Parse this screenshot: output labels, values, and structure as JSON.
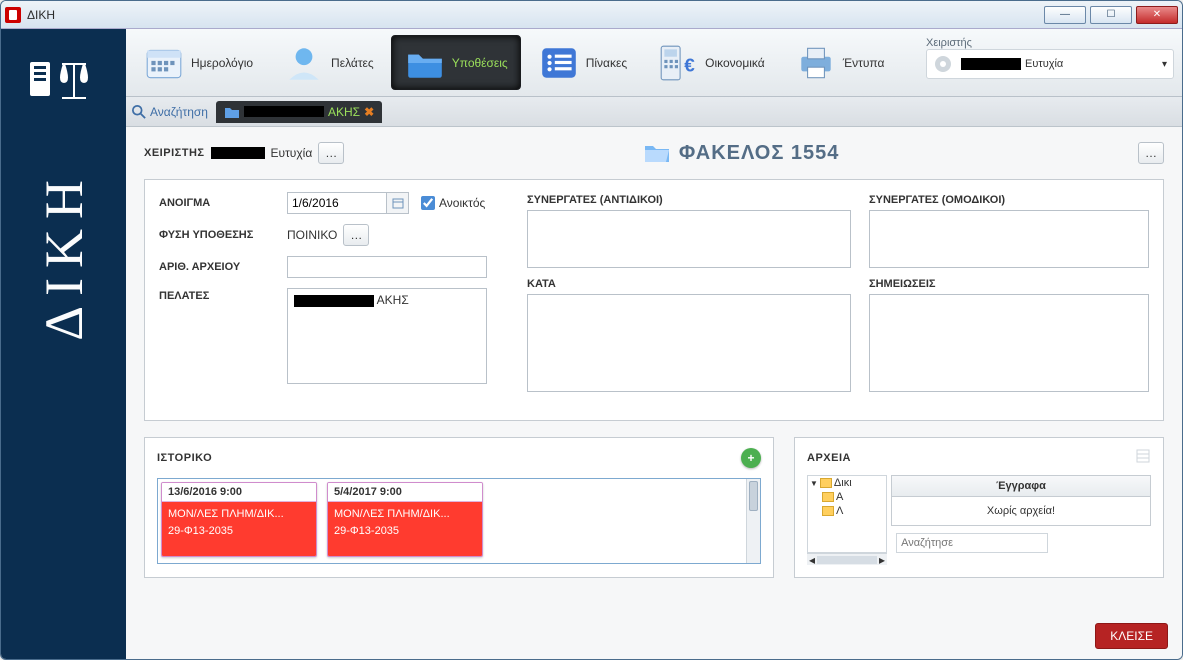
{
  "window": {
    "title": "ΔΙΚΗ"
  },
  "sidebar": {
    "brand_vertical": "ΔΙΚΗ"
  },
  "toolbar": {
    "calendar": "Ημερολόγιο",
    "clients": "Πελάτες",
    "cases": "Υποθέσεις",
    "tables": "Πίνακες",
    "finance": "Οικονομικά",
    "forms": "Έντυπα",
    "operator_label": "Χειριστής",
    "operator_value": "Ευτυχία"
  },
  "tabs": {
    "search": "Αναζήτηση",
    "open_tab_suffix": "ΑΚΗΣ",
    "close_glyph": "✖"
  },
  "header": {
    "handler_label": "ΧΕΙΡΙΣΤΗΣ",
    "handler_value": "Ευτυχία",
    "folder_title": "ΦΑΚΕΛΟΣ 1554"
  },
  "details": {
    "open_label": "ΑΝΟΙΓΜΑ",
    "open_date": "1/6/2016",
    "open_checkbox_label": "Ανοικτός",
    "nature_label": "ΦΥΣΗ ΥΠΟΘΕΣΗΣ",
    "nature_value": "ΠΟΙΝΙΚΟ",
    "fileno_label": "ΑΡΙΘ. ΑΡΧΕΙΟΥ",
    "clients_label": "ΠΕΛΑΤΕΣ",
    "client_row_suffix": "ΑΚΗΣ",
    "opp_label": "ΣΥΝΕΡΓΑΤΕΣ (ΑΝΤΙΔΙΚΟΙ)",
    "kata_label": "ΚΑΤΑ",
    "team_label": "ΣΥΝΕΡΓΑΤΕΣ (ΟΜΟΔΙΚΟΙ)",
    "notes_label": "ΣΗΜΕΙΩΣΕΙΣ"
  },
  "history": {
    "title": "ΙΣΤΟΡΙΚΟ",
    "cards": [
      {
        "date": "13/6/2016 9:00",
        "line1": "ΜΟΝ/ΛΕΣ ΠΛΗΜ/ΔΙΚ...",
        "line2": "29-Φ13-2035"
      },
      {
        "date": "5/4/2017 9:00",
        "line1": "ΜΟΝ/ΛΕΣ ΠΛΗΜ/ΔΙΚ...",
        "line2": "29-Φ13-2035"
      }
    ]
  },
  "files": {
    "title": "ΑΡΧΕΙΑ",
    "tree_root": "Δικι",
    "tree_child1": "Α",
    "tree_child2": "Λ",
    "docs_header": "Έγγραφα",
    "docs_empty": "Χωρίς αρχεία!",
    "search_placeholder": "Αναζήτησε"
  },
  "footer": {
    "close": "ΚΛΕΙΣΕ"
  }
}
